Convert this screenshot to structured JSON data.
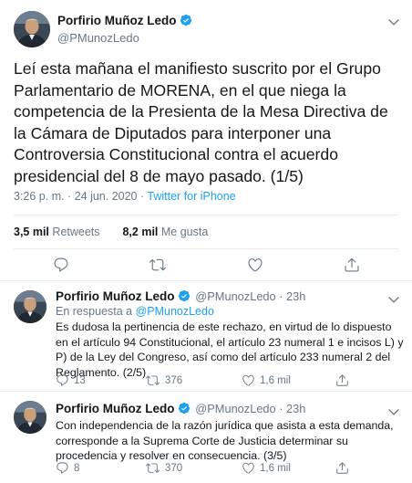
{
  "main_tweet": {
    "author_name": "Porfirio Muñoz Ledo",
    "handle": "@PMunozLedo",
    "text": "Leí esta mañana el manifiesto suscrito por el Grupo Parlamentario de MORENA, en el que niega la competencia de la Presienta de la Mesa Directiva de la Cámara de Diputados para interponer una Controversia Constitucional contra el acuerdo presidencial del 8 de mayo pasado. (1/5)",
    "time": "3:26 p. m. · 24 jun. 2020 · ",
    "source": "Twitter for iPhone",
    "retweets_count": "3,5 mil",
    "retweets_label": " Retweets",
    "likes_count": "8,2 mil",
    "likes_label": " Me gusta",
    "icons": [
      "reply-icon",
      "retweet-icon",
      "like-icon",
      "share-icon",
      "chevron-down-icon",
      "verified-badge-icon"
    ]
  },
  "replies": [
    {
      "author_name": "Porfirio Muñoz Ledo",
      "handle_time": "@PMunozLedo · 23h",
      "reply_to_label": "En respuesta a ",
      "reply_to_handle": "@PMunozLedo",
      "text": "Es dudosa la pertinencia de este rechazo, en virtud de lo dispuesto en el artículo 94 Constitucional, el artículo 23 numeral 1 e incisos L) y P) de la Ley del Congreso, así como del artículo 233 numeral 2 del Reglamento. (2/5)",
      "reply_count": "13",
      "retweet_count": "376",
      "like_count": "1,6 mil"
    },
    {
      "author_name": "Porfirio Muñoz Ledo",
      "handle_time": "@PMunozLedo · 23h",
      "text": "Con independencia de la razón jurídica que asista a esta demanda, corresponde a la Suprema Corte de Justicia determinar su procedencia y resolver en consecuencia. (3/5)",
      "reply_count": "8",
      "retweet_count": "370",
      "like_count": "1,6 mil"
    }
  ],
  "colors": {
    "accent": "#1da1f2",
    "secondary_text": "#657786",
    "border": "#e6ecf0"
  }
}
